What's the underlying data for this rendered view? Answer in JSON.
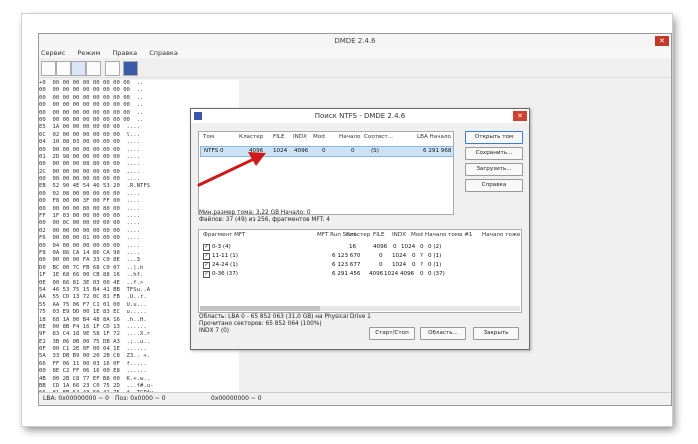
{
  "app": {
    "title": "DMDE 2.4.6",
    "close_glyph": "✕",
    "menu": [
      "Сервис",
      "Режим",
      "Правка",
      "Справка"
    ]
  },
  "hex": {
    "lines": [
      "+0  00 00 00 00 00 00 00 00  ..",
      "00  00 00 00 00 00 00 00 00  ..",
      "00  00 00 00 00 00 00 00 00  ..",
      "00  00 00 00 00 00 00 00 00  ..",
      "00  00 00 00 00 00 00 00 00  ..",
      "00  00 00 00 00 00 00 00 00  ..",
      "E5  1A 00 00 00 00 00 00  ....",
      "6C  02 00 00 00 00 00 00  l...",
      "04  10 08 03 00 00 00 00  ....",
      "00  00 00 00 00 00 00 00  ....",
      "01  2D 98 00 00 00 00 00  ....",
      "00  00 00 00 08 80 00 00  ....",
      "2C  00 00 00 00 00 00 00  ,...",
      "00  00 00 00 00 00 00 00  ....",
      "EB  52 90 4E 54 46 53 20  .R.NTFS",
      "00  02 08 00 00 00 00 00  ....",
      "00  F8 00 00 3F 00 FF 00  ....",
      "00  00 00 00 80 00 80 00  ....",
      "FF  1F 03 00 00 00 00 00  ....",
      "00  00 0C 00 00 00 00 00  ....",
      "02  00 00 00 00 00 00 00  ....",
      "F6  00 00 00 01 00 00 00  ....",
      "00  04 00 00 00 00 00 00  ....",
      "F8  0A 86 CA 14 86 CA 98  ....",
      "00  00 00 00 FA 33 C0 8E  ...3",
      "D0  BC 00 7C FB 68 C0 07  ..|.h",
      "1F  1E 68 66 00 CB 88 16  ..hf.",
      "0E  00 66 81 3E 03 00 4E  ..f.>",
      "54  46 53 75 15 B4 41 BB  TFSu..A",
      "AA  55 CD 13 72 0C 81 FB  .U..r.",
      "55  AA 75 06 F7 C1 01 00  U.u...",
      "75  03 E9 DD 00 1E 83 EC  u.....",
      "18  68 1A 00 B4 48 8A 16  .h..H.",
      "0E  00 8B F4 16 1F CD 13  ......",
      "9F  83 C4 18 9E 58 1F 72  ....X.r",
      "E1  3B 06 0B 00 75 DB A3  .;..u..",
      "0F  00 C1 2E 0F 00 04 1E  ......",
      "5A  33 DB B9 00 20 2B C8  Z3.. +.",
      "66  FF 06 11 00 03 16 0F  f.....",
      "00  8E C2 FF 06 16 00 E8  ......",
      "4B  00 2B C8 77 EF B8 00  K.+.w..",
      "BB  CD 1A 66 23 C0 75 2D  ...f#.u-",
      "66  81 FB 54 43 50 41 75  f..TCPAu",
      "24  81 F9 02 01 72 1E 16  $....r.",
      "68  07 BB 16 68 52 11 16  h...hR.",
      "68  09 00 66 53 66 53 66  h..fSfSf",
      "55  16 16 16 68 B8 01 66  U...h..f",
      "61  0E 07 CD 1A 33 C0 BF  a....3..",
      "0A  13 B9 F6 0C FC F3 AA  .......",
      "E9  FE 01 90 90 66 60 1E  .....f`.",
      "06  66 A1 11 00 66 03 06  .f...f..",
      "1C  00 1E 66 68 00 00 00  ...fh..."
    ]
  },
  "status": {
    "lba": "LBA: 0x00000000 ~ 0",
    "pos": "Поз: 0x0000 ~ 0",
    "right": "0x00000000 ~ 0"
  },
  "dialog": {
    "title": "Поиск NTFS - DMDE 2.4.6",
    "close_glyph": "✕",
    "vol_headers": [
      "Том",
      "Кластер",
      "FILE",
      "INDX",
      "Mod",
      "Начало",
      "Соотвст...",
      "LBA Начало"
    ],
    "vol_row": {
      "name": "NTFS 0",
      "cluster": "4096",
      "file": "1024",
      "indx": "4096",
      "mod": "0",
      "start": "0",
      "match": "(S)",
      "lba": "6 291 968"
    },
    "buttons": {
      "open_volume": "Открыть том",
      "save": "Сохранить...",
      "load": "Загрузить...",
      "help": "Справка",
      "start_stop": "Старт/Стоп",
      "region": "Область...",
      "close": "Закрыть"
    },
    "info1": "Мин.размер тома: 3,22 GB Начало: 0",
    "info2": "Файлов: 37 (49) из 256, фрагментов MFT: 4",
    "frag_headers": [
      "Фрагмент MFT",
      "MFT Run Start",
      "Кластер",
      "FILE",
      "INDX",
      "Mod",
      "Начало тома #1",
      "Начало тоже"
    ],
    "frag_rows": [
      {
        "name": "0-3 (4)",
        "run": "16",
        "cluster": "4096",
        "file": "0",
        "indx": "1024",
        "mod": "0",
        "begin": "0 (2)"
      },
      {
        "name": "11-11 (1)",
        "run": "6 123 670",
        "cluster": "0",
        "file": "1024",
        "indx": "0",
        "mod": "?",
        "begin": "0 (1)"
      },
      {
        "name": "24-24 (1)",
        "run": "6 123 677",
        "cluster": "0",
        "file": "1024",
        "indx": "0",
        "mod": "?",
        "begin": "0 (1)"
      },
      {
        "name": "0-36 (37)",
        "run": "6 291 456",
        "cluster": "4096",
        "file": "1024",
        "indx": "4096",
        "mod": "0",
        "begin": "0 (37)"
      }
    ],
    "area": "Область: LBA 0 - 65 852 063 (31,0 GB) на Physical Drive 1",
    "read": "Прочитано секторов: 65 852 064 (100%)",
    "indx": "INDX 7 (0)"
  },
  "colors": {
    "arrow": "#d01818",
    "selection": "#cce3f7"
  }
}
